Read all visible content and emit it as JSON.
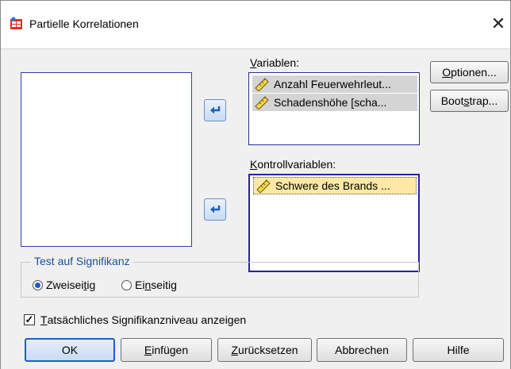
{
  "window": {
    "title": "Partielle Korrelationen",
    "close_glyph": "✕"
  },
  "variables": {
    "label_prefix": "",
    "label_mnemonic": "V",
    "label_rest": "ariablen:",
    "items": [
      "Anzahl Feuerwehrleut...",
      "Schadenshöhe [scha..."
    ]
  },
  "controls": {
    "label_mnemonic": "K",
    "label_rest": "ontrollvariablen:",
    "items": [
      "Schwere des Brands ..."
    ]
  },
  "side_buttons": {
    "options_prefix": "",
    "options_mnemonic": "O",
    "options_rest": "ptionen...",
    "bootstrap_prefix": "Boot",
    "bootstrap_mnemonic": "s",
    "bootstrap_rest": "trap..."
  },
  "significance": {
    "title": "Test auf Signifikanz",
    "two_sided_prefix": "Zweisei",
    "two_sided_mnemonic": "t",
    "two_sided_rest": "ig",
    "one_sided_prefix": "Ei",
    "one_sided_mnemonic": "n",
    "one_sided_rest": "seitig",
    "selected": "two_sided"
  },
  "show_level": {
    "mnemonic": "T",
    "rest": "atsächliches Signifikanzniveau anzeigen",
    "checked": true
  },
  "bottom_buttons": {
    "ok": "OK",
    "insert_mnemonic": "E",
    "insert_rest": "infügen",
    "reset_mnemonic": "Z",
    "reset_rest": "urücksetzen",
    "cancel": "Abbrechen",
    "help": "Hilfe"
  },
  "colors": {
    "accent_blue": "#2a1fa0",
    "selected_gray": "#d4d4d4",
    "selected_yellow": "#fde9a5",
    "group_title": "#1a4f9c"
  },
  "icons": {
    "app": "spss-table-icon",
    "variable": "scale-ruler-icon",
    "arrow": "move-arrow-icon"
  }
}
